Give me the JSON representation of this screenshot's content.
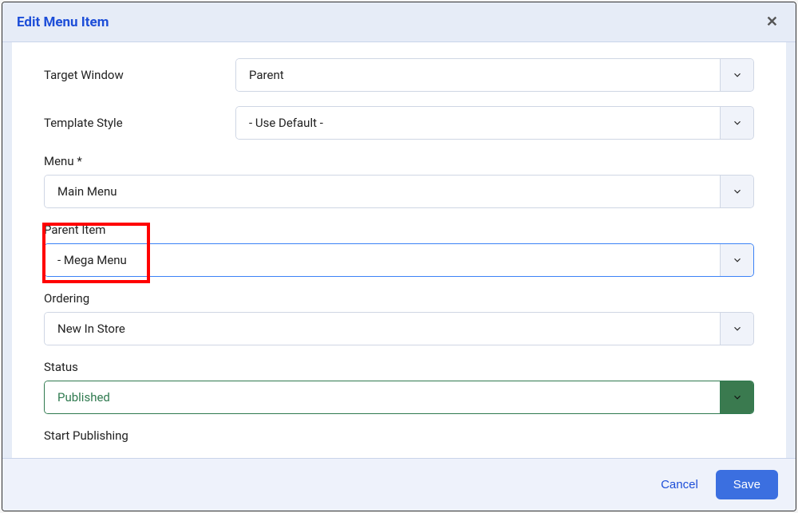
{
  "modal": {
    "title": "Edit Menu Item",
    "close_symbol": "✕"
  },
  "fields": {
    "target_window": {
      "label": "Target Window",
      "value": "Parent"
    },
    "template_style": {
      "label": "Template Style",
      "value": "- Use Default -"
    },
    "menu": {
      "label": "Menu *",
      "value": "Main Menu"
    },
    "parent_item": {
      "label": "Parent Item",
      "value": "- Mega Menu"
    },
    "ordering": {
      "label": "Ordering",
      "value": "New In Store"
    },
    "status": {
      "label": "Status",
      "value": "Published"
    },
    "start_publishing": {
      "label": "Start Publishing"
    }
  },
  "footer": {
    "cancel": "Cancel",
    "save": "Save"
  }
}
